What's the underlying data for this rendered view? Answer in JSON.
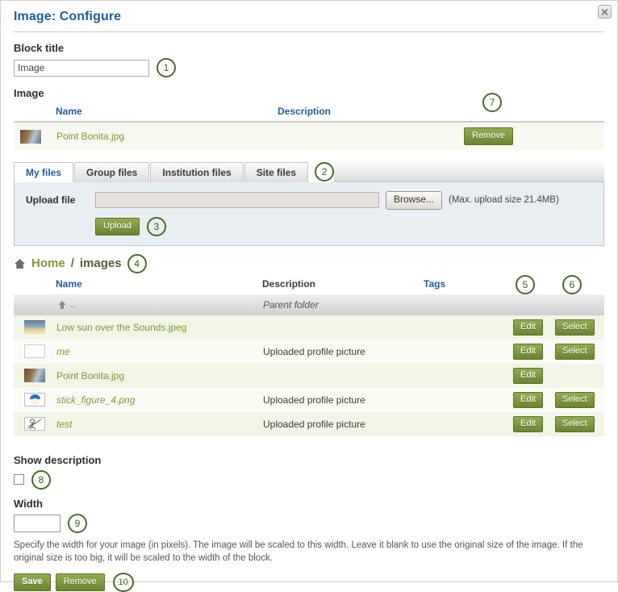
{
  "dialog": {
    "title": "Image: Configure",
    "close_icon": "close-icon"
  },
  "block_title": {
    "label": "Block title",
    "value": "Image",
    "callout": "1"
  },
  "image_section": {
    "label": "Image",
    "columns": {
      "name": "Name",
      "description": "Description"
    },
    "selected_file": {
      "name": "Point Bonita.jpg",
      "description": "",
      "remove_label": "Remove",
      "remove_callout": "7",
      "thumb": "photo-thumb-point-bonita"
    }
  },
  "tabs": {
    "callout": "2",
    "items": [
      {
        "label": "My files",
        "active": true
      },
      {
        "label": "Group files",
        "active": false
      },
      {
        "label": "Institution files",
        "active": false
      },
      {
        "label": "Site files",
        "active": false
      }
    ]
  },
  "upload": {
    "label": "Upload file",
    "file_value": "",
    "browse_label": "Browse...",
    "max_size_note": "(Max. upload size 21.4MB)",
    "upload_label": "Upload",
    "callout": "3"
  },
  "breadcrumb": {
    "home_icon": "home-icon",
    "home_label": "Home",
    "separator": "/",
    "current": "images",
    "callout": "4"
  },
  "file_list": {
    "columns": {
      "name": "Name",
      "description": "Description",
      "tags": "Tags"
    },
    "edit_callout": "5",
    "select_callout": "6",
    "parent": {
      "label": "..",
      "description": "Parent folder",
      "icon": "arrow-up-icon"
    },
    "edit_label": "Edit",
    "select_label": "Select",
    "rows": [
      {
        "name": "Low sun over the Sounds.jpeg",
        "italic": false,
        "description": "",
        "tags": "",
        "has_select": true,
        "thumb": "sunset-thumb"
      },
      {
        "name": "me",
        "italic": true,
        "description": "Uploaded profile picture",
        "tags": "",
        "has_select": true,
        "thumb": "sketch-thumb"
      },
      {
        "name": "Point Bonita.jpg",
        "italic": false,
        "description": "",
        "tags": "",
        "has_select": false,
        "thumb": "photo-thumb-point-bonita"
      },
      {
        "name": "stick_figure_4.png",
        "italic": true,
        "description": "Uploaded profile picture",
        "tags": "",
        "has_select": true,
        "thumb": "face-thumb"
      },
      {
        "name": "test",
        "italic": true,
        "description": "Uploaded profile picture",
        "tags": "",
        "has_select": true,
        "thumb": "stickfigure-thumb"
      }
    ]
  },
  "show_description": {
    "label": "Show description",
    "checked": false,
    "callout": "8"
  },
  "width": {
    "label": "Width",
    "value": "",
    "callout": "9",
    "hint": "Specify the width for your image (in pixels). The image will be scaled to this width. Leave it blank to use the original size of the image. If the original size is too big, it will be scaled to the width of the block."
  },
  "footer": {
    "save_label": "Save",
    "remove_label": "Remove",
    "callout": "10"
  },
  "colors": {
    "link_blue": "#1f5c9e",
    "olive": "#7e9a33",
    "button_green": "#6d8430",
    "callout_green": "#4a6b22",
    "panel_blue": "#e8eef2"
  }
}
